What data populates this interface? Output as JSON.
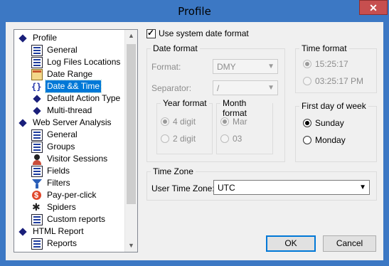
{
  "window": {
    "title": "Profile",
    "close_symbol": "✕"
  },
  "tree": {
    "items": [
      {
        "label": "Profile",
        "icon": "diamond-icon",
        "selected": false
      },
      {
        "label": "General",
        "icon": "grid-icon",
        "selected": false
      },
      {
        "label": "Log Files Locations",
        "icon": "grid-icon",
        "selected": false
      },
      {
        "label": "Date Range",
        "icon": "calendar-icon",
        "selected": false
      },
      {
        "label": "Date && Time",
        "icon": "braces-icon",
        "selected": true
      },
      {
        "label": "Default Action Type",
        "icon": "diamond-icon",
        "selected": false
      },
      {
        "label": "Multi-thread",
        "icon": "diamond-icon",
        "selected": false
      },
      {
        "label": "Web Server Analysis",
        "icon": "diamond-icon",
        "selected": false
      },
      {
        "label": "General",
        "icon": "grid-icon",
        "selected": false
      },
      {
        "label": "Groups",
        "icon": "grid-icon",
        "selected": false
      },
      {
        "label": "Visitor Sessions",
        "icon": "user-icon",
        "selected": false
      },
      {
        "label": "Fields",
        "icon": "grid-icon",
        "selected": false
      },
      {
        "label": "Filters",
        "icon": "funnel-icon",
        "selected": false
      },
      {
        "label": "Pay-per-click",
        "icon": "ppc-icon",
        "selected": false
      },
      {
        "label": "Spiders",
        "icon": "spider-icon",
        "selected": false
      },
      {
        "label": "Custom reports",
        "icon": "grid-icon",
        "selected": false
      },
      {
        "label": "HTML Report",
        "icon": "diamond-icon",
        "selected": false
      },
      {
        "label": "Reports",
        "icon": "grid-icon",
        "selected": false
      }
    ],
    "scroll_up": "▲",
    "scroll_down": "▼"
  },
  "use_system_date": {
    "label": "Use system date format",
    "checked": true
  },
  "date_format": {
    "title": "Date format",
    "format_label": "Format:",
    "format_value": "DMY",
    "separator_label": "Separator:",
    "separator_value": "/",
    "year_title": "Year format",
    "year_options": [
      "4 digit",
      "2 digit"
    ],
    "year_selected": 0,
    "month_title": "Month format",
    "month_options": [
      "Mar",
      "03"
    ],
    "month_selected": 0
  },
  "time_format": {
    "title": "Time format",
    "options": [
      "15:25:17",
      "03:25:17 PM"
    ],
    "selected": 0
  },
  "first_day": {
    "title": "First day of week",
    "options": [
      "Sunday",
      "Monday"
    ],
    "selected": 0
  },
  "time_zone": {
    "title": "Time Zone",
    "label": "User Time Zone:",
    "value": "UTC"
  },
  "buttons": {
    "ok": "OK",
    "cancel": "Cancel"
  }
}
